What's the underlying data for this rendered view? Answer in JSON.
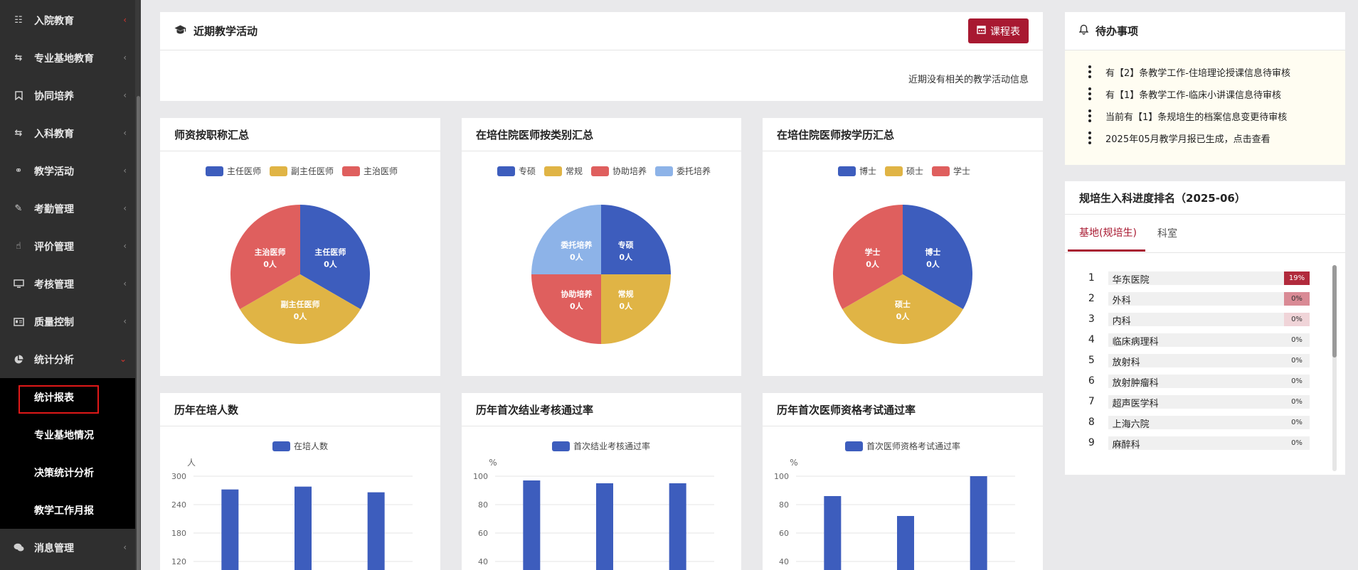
{
  "sidebar": {
    "items": [
      {
        "label": "入院教育",
        "icon": "clipboard-icon"
      },
      {
        "label": "专业基地教育",
        "icon": "exchange-icon"
      },
      {
        "label": "协同培养",
        "icon": "bookmark-icon"
      },
      {
        "label": "入科教育",
        "icon": "exchange-icon"
      },
      {
        "label": "教学活动",
        "icon": "stethoscope-icon"
      },
      {
        "label": "考勤管理",
        "icon": "brush-icon"
      },
      {
        "label": "评价管理",
        "icon": "thumbs-up-icon"
      },
      {
        "label": "考核管理",
        "icon": "monitor-icon"
      },
      {
        "label": "质量控制",
        "icon": "id-card-icon"
      },
      {
        "label": "统计分析",
        "icon": "pie-chart-icon"
      }
    ],
    "sub_items": [
      "统计报表",
      "专业基地情况",
      "决策统计分析",
      "教学工作月报"
    ],
    "last_item": {
      "label": "消息管理",
      "icon": "comments-icon"
    }
  },
  "activity": {
    "title": "近期教学活动",
    "schedule_button": "课程表",
    "empty_text": "近期没有相关的教学活动信息"
  },
  "todo": {
    "title": "待办事项",
    "items": [
      "有【2】条教学工作-住培理论授课信息待审核",
      "有【1】条教学工作-临床小讲课信息待审核",
      "当前有【1】条规培生的档案信息变更待审核",
      "2025年05月教学月报已生成，点击查看"
    ]
  },
  "ranking": {
    "title": "规培生入科进度排名（2025-06）",
    "tabs": [
      "基地(规培生)",
      "科室"
    ],
    "rows": [
      {
        "no": "1",
        "name": "华东医院",
        "pct": "19%"
      },
      {
        "no": "2",
        "name": "外科",
        "pct": "0%"
      },
      {
        "no": "3",
        "name": "内科",
        "pct": "0%"
      },
      {
        "no": "4",
        "name": "临床病理科",
        "pct": "0%"
      },
      {
        "no": "5",
        "name": "放射科",
        "pct": "0%"
      },
      {
        "no": "6",
        "name": "放射肿瘤科",
        "pct": "0%"
      },
      {
        "no": "7",
        "name": "超声医学科",
        "pct": "0%"
      },
      {
        "no": "8",
        "name": "上海六院",
        "pct": "0%"
      },
      {
        "no": "9",
        "name": "麻醉科",
        "pct": "0%"
      }
    ]
  },
  "colors": {
    "blue": "#3d5dbd",
    "yellow": "#e0b445",
    "red": "#df5f5e",
    "lightblue": "#8db3e8",
    "brand": "#a81931"
  },
  "chart_data": [
    {
      "type": "pie",
      "title": "师资按职称汇总",
      "legend": [
        "主任医师",
        "副主任医师",
        "主治医师"
      ],
      "slices": [
        {
          "name": "主任医师",
          "value": "0人"
        },
        {
          "name": "副主任医师",
          "value": "0人"
        },
        {
          "name": "主治医师",
          "value": "0人"
        }
      ]
    },
    {
      "type": "pie",
      "title": "在培住院医师按类别汇总",
      "legend": [
        "专硕",
        "常规",
        "协助培养",
        "委托培养"
      ],
      "slices": [
        {
          "name": "专硕",
          "value": "0人"
        },
        {
          "name": "常规",
          "value": "0人"
        },
        {
          "name": "协助培养",
          "value": "0人"
        },
        {
          "name": "委托培养",
          "value": "0人"
        }
      ]
    },
    {
      "type": "pie",
      "title": "在培住院医师按学历汇总",
      "legend": [
        "博士",
        "硕士",
        "学士"
      ],
      "slices": [
        {
          "name": "博士",
          "value": "0人"
        },
        {
          "name": "硕士",
          "value": "0人"
        },
        {
          "name": "学士",
          "value": "0人"
        }
      ]
    },
    {
      "type": "bar",
      "title": "历年在培人数",
      "legend": [
        "在培人数"
      ],
      "ylabel": "人",
      "yticks": [
        "120",
        "180",
        "240",
        "300"
      ],
      "ylim": [
        120,
        300
      ],
      "values": [
        272,
        278,
        266
      ]
    },
    {
      "type": "bar",
      "title": "历年首次结业考核通过率",
      "legend": [
        "首次结业考核通过率"
      ],
      "ylabel": "%",
      "yticks": [
        "40",
        "60",
        "80",
        "100"
      ],
      "ylim": [
        40,
        100
      ],
      "values": [
        97,
        95,
        95
      ]
    },
    {
      "type": "bar",
      "title": "历年首次医师资格考试通过率",
      "legend": [
        "首次医师资格考试通过率"
      ],
      "ylabel": "%",
      "yticks": [
        "40",
        "60",
        "80",
        "100"
      ],
      "ylim": [
        40,
        100
      ],
      "values": [
        86,
        72,
        100
      ]
    }
  ]
}
